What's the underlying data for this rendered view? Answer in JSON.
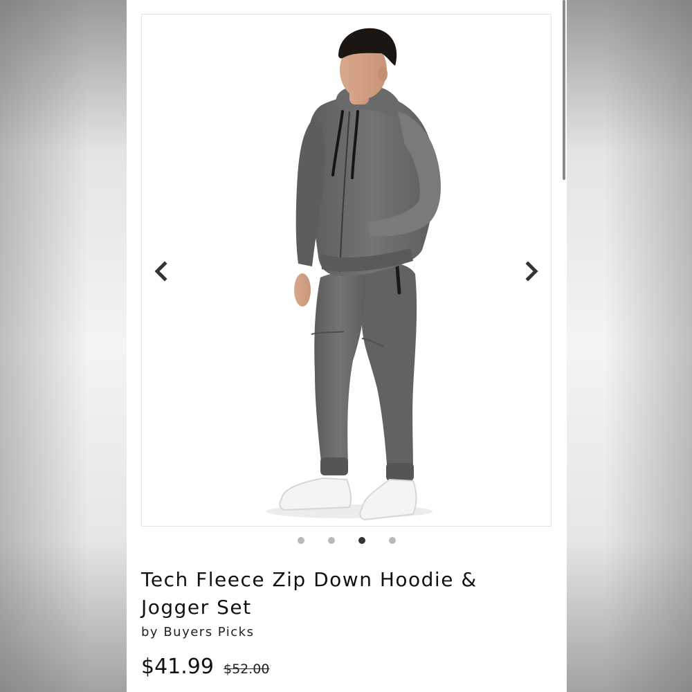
{
  "gallery": {
    "image_alt": "Man wearing grey tech fleece zip hoodie and jogger set with white sneakers",
    "prev_icon": "chevron-left-icon",
    "next_icon": "chevron-right-icon",
    "dot_count": 4,
    "active_dot": 3,
    "colors": {
      "fleece": "#6b6b6b",
      "sneakers": "#f4f4f4",
      "active_dot": "#333333",
      "inactive_dot": "#b8b8b8"
    }
  },
  "product": {
    "title": "Tech Fleece Zip Down Hoodie & Jogger Set",
    "brand_prefix": "by",
    "brand": "Buyers Picks",
    "price": "$41.99",
    "compare_price": "$52.00"
  }
}
